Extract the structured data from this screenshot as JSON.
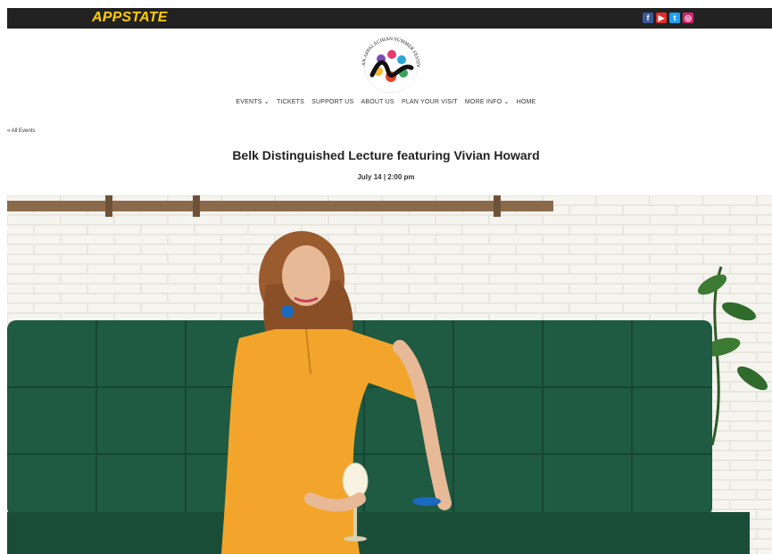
{
  "header": {
    "brand": "APPSTATE",
    "socials": [
      {
        "name": "facebook",
        "glyph": "f",
        "color": "#3b5998"
      },
      {
        "name": "youtube",
        "glyph": "▶",
        "color": "#e52d27"
      },
      {
        "name": "twitter",
        "glyph": "t",
        "color": "#1da1f2"
      },
      {
        "name": "instagram",
        "glyph": "◎",
        "color": "#d6246e"
      }
    ]
  },
  "logo": {
    "ring_text": "AN APPALACHIAN SUMMER FESTIVAL"
  },
  "nav": {
    "items": [
      "EVENTS ⌄",
      "TICKETS",
      "SUPPORT US",
      "ABOUT US",
      "PLAN YOUR VISIT",
      "MORE INFO ⌄",
      "HOME"
    ]
  },
  "event": {
    "back_link": "« All Events",
    "title": "Belk Distinguished Lecture featuring Vivian Howard",
    "date": "July 14 | 2:00 pm"
  },
  "colors": {
    "topbar": "#222222",
    "brand": "#ffcc00",
    "sofa": "#1f5a42",
    "dress": "#f2a52a",
    "wall": "#f3f1ec"
  }
}
